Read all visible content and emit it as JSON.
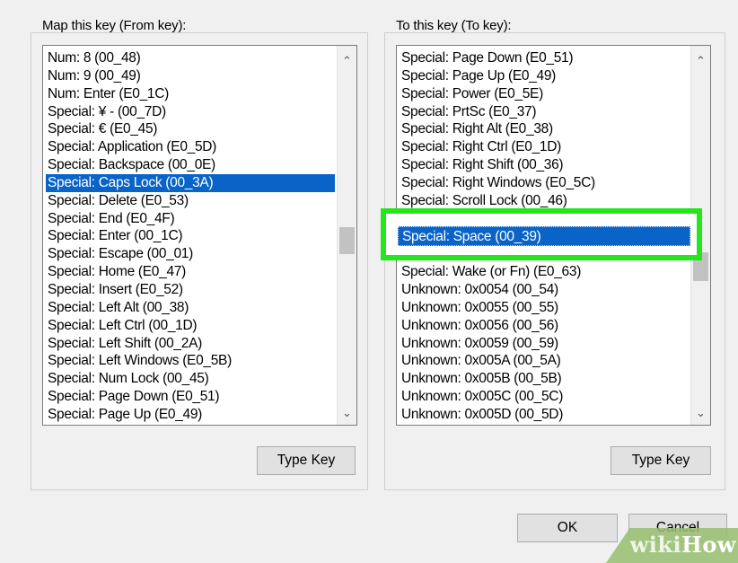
{
  "from_key": {
    "label": "Map this key (From key):",
    "items": [
      "Num: 8 (00_48)",
      "Num: 9 (00_49)",
      "Num: Enter (E0_1C)",
      "Special: ¥ - (00_7D)",
      "Special: € (E0_45)",
      "Special: Application (E0_5D)",
      "Special: Backspace (00_0E)",
      "Special: Caps Lock (00_3A)",
      "Special: Delete (E0_53)",
      "Special: End (E0_4F)",
      "Special: Enter (00_1C)",
      "Special: Escape (00_01)",
      "Special: Home (E0_47)",
      "Special: Insert (E0_52)",
      "Special: Left Alt (00_38)",
      "Special: Left Ctrl (00_1D)",
      "Special: Left Shift (00_2A)",
      "Special: Left Windows (E0_5B)",
      "Special: Num Lock (00_45)",
      "Special: Page Down (E0_51)",
      "Special: Page Up (E0_49)"
    ],
    "selected_index": 7,
    "type_key_label": "Type Key"
  },
  "to_key": {
    "label": "To this key (To key):",
    "items": [
      "Special: Page Down (E0_51)",
      "Special: Page Up (E0_49)",
      "Special: Power (E0_5E)",
      "Special: PrtSc (E0_37)",
      "Special: Right Alt (E0_38)",
      "Special: Right Ctrl (E0_1D)",
      "Special: Right Shift (00_36)",
      "Special: Right Windows (E0_5C)",
      "Special: Scroll Lock (00_46)",
      "",
      "",
      "",
      "Special: Wake (or Fn) (E0_63)",
      "Unknown: 0x0054 (00_54)",
      "Unknown: 0x0055 (00_55)",
      "Unknown: 0x0056 (00_56)",
      "Unknown: 0x0059 (00_59)",
      "Unknown: 0x005A (00_5A)",
      "Unknown: 0x005B (00_5B)",
      "Unknown: 0x005C (00_5C)",
      "Unknown: 0x005D (00_5D)"
    ],
    "selected_item": "Special: Space (00_39)",
    "type_key_label": "Type Key"
  },
  "buttons": {
    "ok": "OK",
    "cancel": "Cancel"
  },
  "scroll_icons": {
    "up": "chevron-up-icon",
    "down": "chevron-down-icon"
  },
  "watermark": {
    "part1": "wiki",
    "part2": "How"
  },
  "colors": {
    "selection": "#0a64c8",
    "highlight_frame": "#25e61c"
  }
}
